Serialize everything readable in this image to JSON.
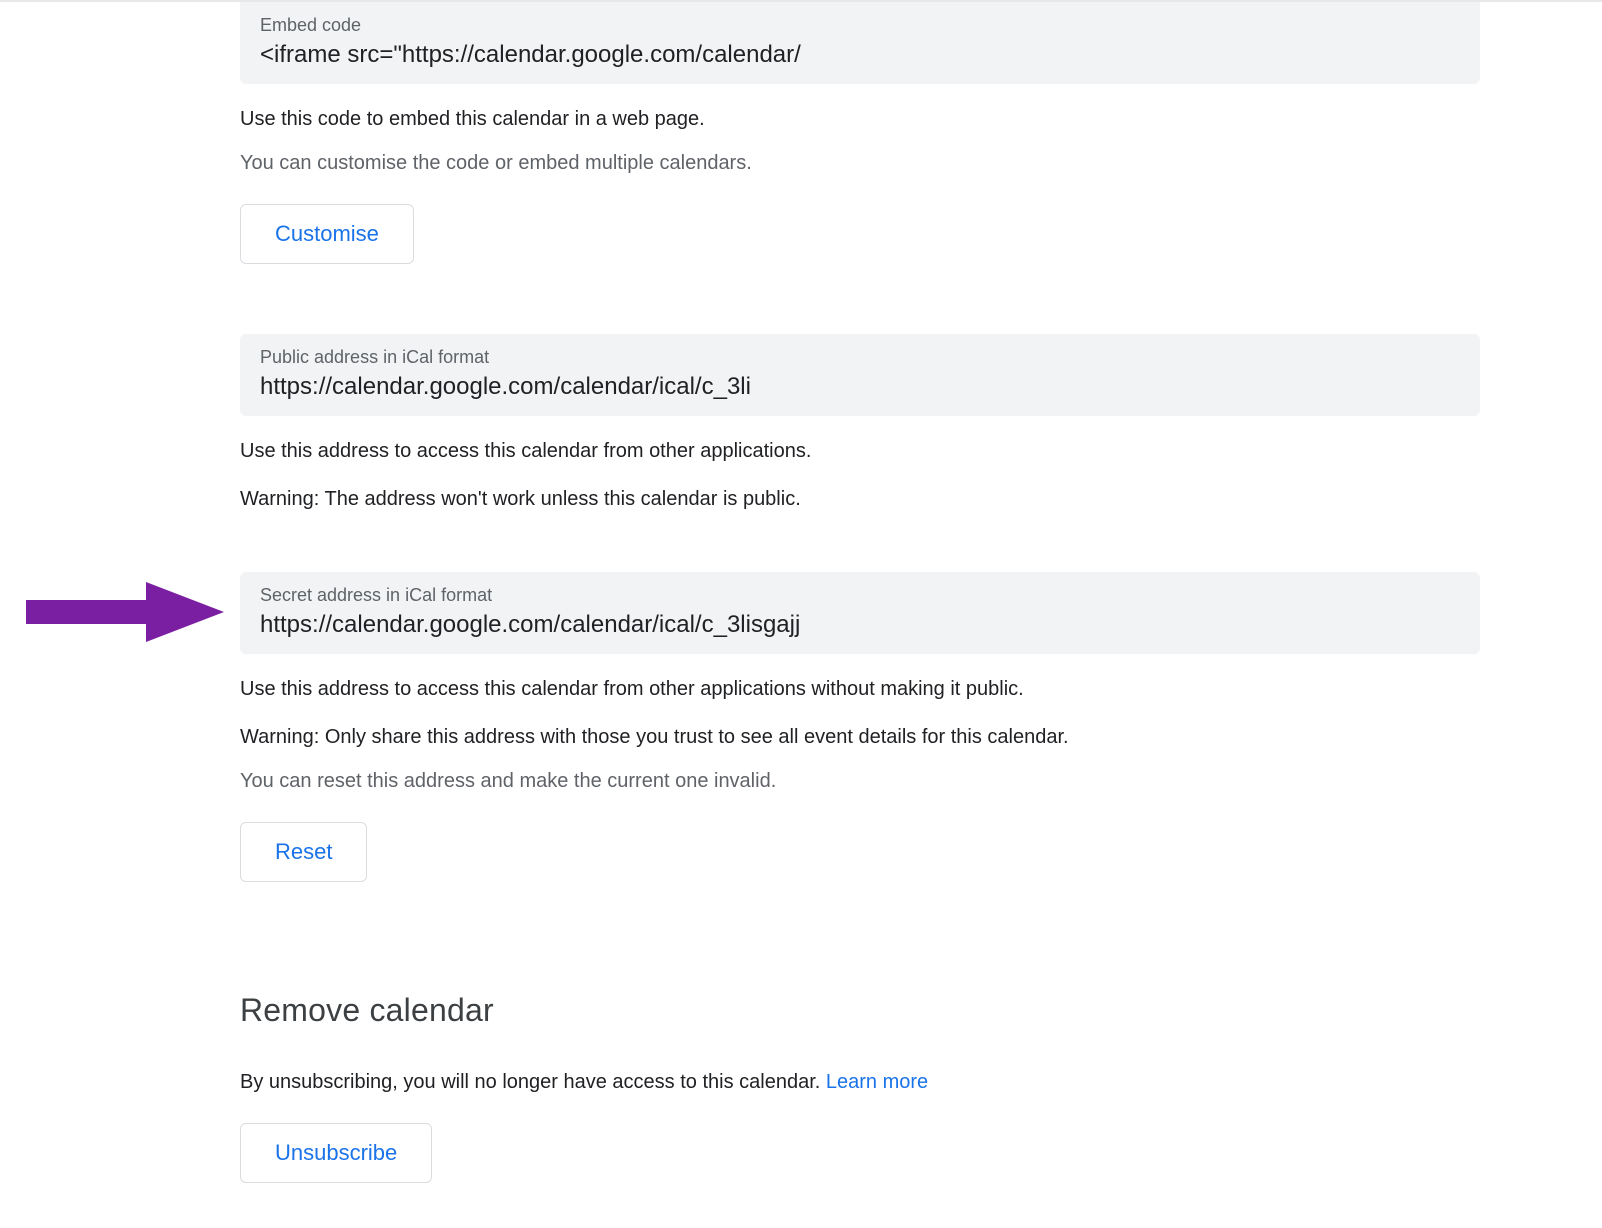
{
  "embed": {
    "label": "Embed code",
    "value": "<iframe src=\"https://calendar.google.com/calendar/",
    "help1": "Use this code to embed this calendar in a web page.",
    "help2": "You can customise the code or embed multiple calendars.",
    "button": "Customise"
  },
  "publicIcal": {
    "label": "Public address in iCal format",
    "value": "https://calendar.google.com/calendar/ical/c_3li",
    "help1": "Use this address to access this calendar from other applications.",
    "help2": "Warning: The address won't work unless this calendar is public."
  },
  "secretIcal": {
    "label": "Secret address in iCal format",
    "value": "https://calendar.google.com/calendar/ical/c_3lisgajj",
    "help1": "Use this address to access this calendar from other applications without making it public.",
    "help2": "Warning: Only share this address with those you trust to see all event details for this calendar.",
    "help3": "You can reset this address and make the current one invalid.",
    "button": "Reset"
  },
  "remove": {
    "heading": "Remove calendar",
    "help": "By unsubscribing, you will no longer have access to this calendar. ",
    "learnMore": "Learn more",
    "button": "Unsubscribe"
  }
}
